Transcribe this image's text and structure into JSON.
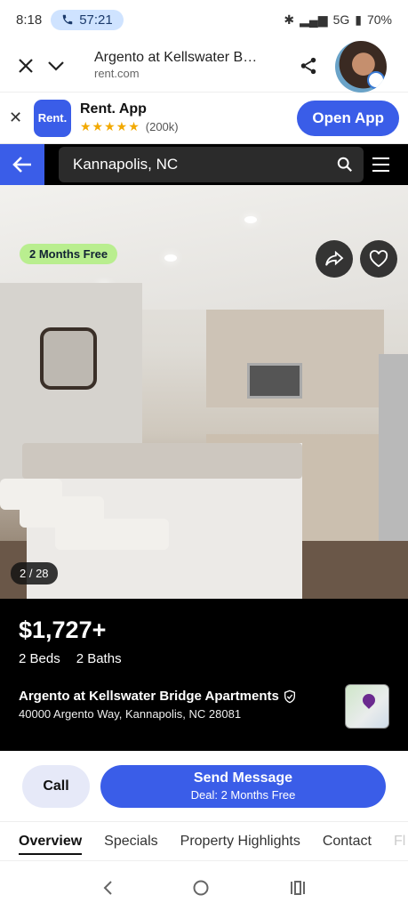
{
  "status_bar": {
    "time": "8:18",
    "call_timer": "57:21",
    "network": "5G",
    "battery": "70%"
  },
  "browser": {
    "page_title": "Argento at Kellswater Bri...",
    "domain": "rent.com"
  },
  "app_banner": {
    "close_label": "✕",
    "logo_text": "Rent.",
    "app_name": "Rent. App",
    "stars": "★★★★★",
    "rating_count": "(200k)",
    "open_label": "Open App"
  },
  "search": {
    "location": "Kannapolis, NC"
  },
  "photo": {
    "badge": "2 Months Free",
    "counter": "2 / 28"
  },
  "listing": {
    "price": "$1,727+",
    "beds": "2 Beds",
    "baths": "2 Baths",
    "name": "Argento at Kellswater Bridge Apartments",
    "address": "40000 Argento Way, Kannapolis, NC 28081"
  },
  "actions": {
    "call_label": "Call",
    "send_label": "Send Message",
    "send_sublabel": "Deal: 2 Months Free"
  },
  "tabs": [
    {
      "label": "Overview"
    },
    {
      "label": "Specials"
    },
    {
      "label": "Property Highlights"
    },
    {
      "label": "Contact"
    },
    {
      "label": "Fl"
    }
  ],
  "colors": {
    "brand_blue": "#3a5de8",
    "badge_green": "#b9ee8f"
  }
}
